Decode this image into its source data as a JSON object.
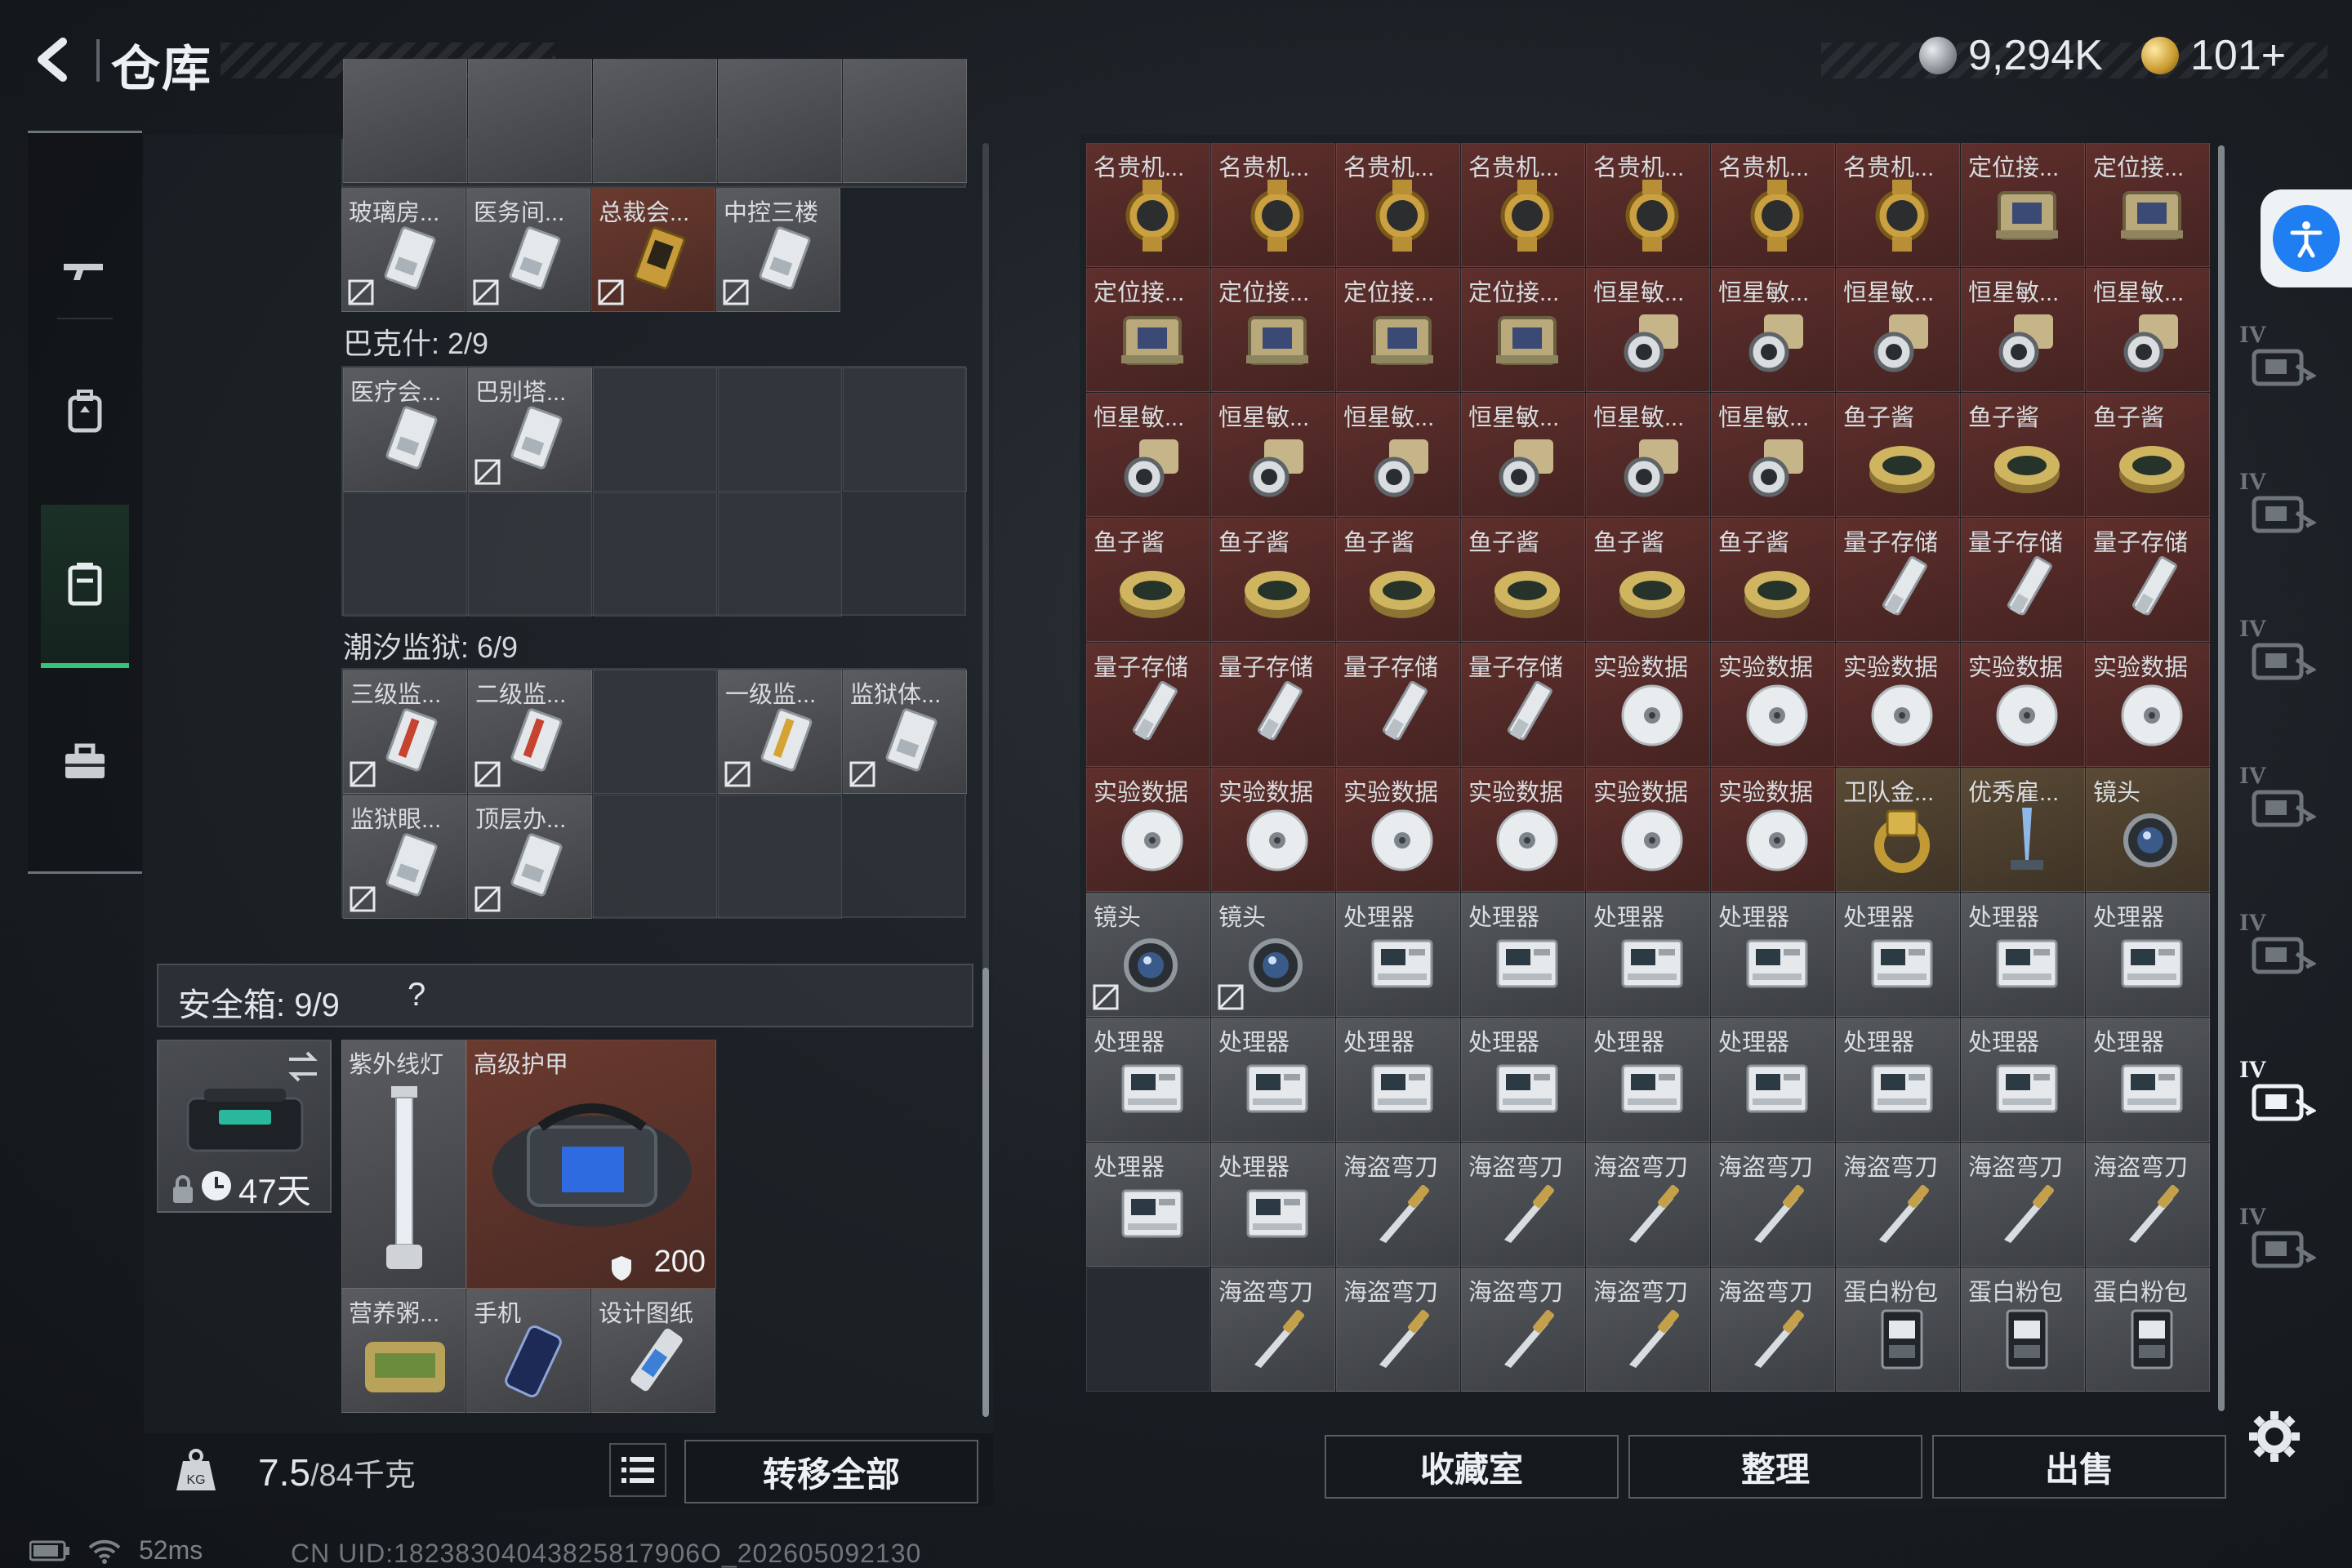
{
  "header": {
    "title": "仓库",
    "currency_1": "9,294K",
    "currency_2": "101+"
  },
  "nav": {
    "items": [
      "weapon-icon",
      "backpack-icon",
      "storage-icon",
      "toolbox-icon"
    ],
    "active_index": 2
  },
  "storage": {
    "top_partial_row": [
      "",
      "",
      "",
      "",
      ""
    ],
    "row_a": [
      "玻璃房...",
      "医务间...",
      "总裁会...",
      "中控三楼"
    ],
    "section_bakshi": {
      "label": "巴克什: 2/9",
      "items": [
        "医疗会...",
        "巴别塔..."
      ]
    },
    "section_tide": {
      "label": "潮汐监狱: 6/9",
      "row1": [
        "三级监...",
        "二级监...",
        "",
        "一级监...",
        "监狱体..."
      ],
      "row2": [
        "监狱眼...",
        "顶层办..."
      ]
    },
    "safe_box": {
      "label": "安全箱:  9/9",
      "help": "?",
      "days": "47天",
      "items": [
        "紫外线灯",
        "高级护甲",
        "营养粥...",
        "手机",
        "设计图纸"
      ],
      "armor_value": "200"
    },
    "weight": {
      "current": "7.5",
      "max": "/84千克"
    },
    "transfer_all": "转移全部"
  },
  "inventory": {
    "items": [
      "名贵机...",
      "名贵机...",
      "名贵机...",
      "名贵机...",
      "名贵机...",
      "名贵机...",
      "名贵机...",
      "定位接...",
      "定位接...",
      "定位接...",
      "定位接...",
      "定位接...",
      "定位接...",
      "恒星敏...",
      "恒星敏...",
      "恒星敏...",
      "恒星敏...",
      "恒星敏...",
      "恒星敏...",
      "恒星敏...",
      "恒星敏...",
      "恒星敏...",
      "恒星敏...",
      "恒星敏...",
      "鱼子酱",
      "鱼子酱",
      "鱼子酱",
      "鱼子酱",
      "鱼子酱",
      "鱼子酱",
      "鱼子酱",
      "鱼子酱",
      "鱼子酱",
      "量子存储",
      "量子存储",
      "量子存储",
      "量子存储",
      "量子存储",
      "量子存储",
      "量子存储",
      "实验数据",
      "实验数据",
      "实验数据",
      "实验数据",
      "实验数据",
      "实验数据",
      "实验数据",
      "实验数据",
      "实验数据",
      "实验数据",
      "实验数据",
      "卫队金...",
      "优秀雇...",
      "镜头",
      "镜头",
      "镜头",
      "处理器",
      "处理器",
      "处理器",
      "处理器",
      "处理器",
      "处理器",
      "处理器",
      "处理器",
      "处理器",
      "处理器",
      "处理器",
      "处理器",
      "处理器",
      "处理器",
      "处理器",
      "处理器",
      "处理器",
      "处理器",
      "海盗弯刀",
      "海盗弯刀",
      "海盗弯刀",
      "海盗弯刀",
      "海盗弯刀",
      "海盗弯刀",
      "海盗弯刀",
      "",
      "海盗弯刀",
      "海盗弯刀",
      "海盗弯刀",
      "海盗弯刀",
      "海盗弯刀",
      "蛋白粉包",
      "蛋白粉包",
      "蛋白粉包"
    ],
    "buttons": {
      "collection": "收藏室",
      "sort": "整理",
      "sell": "出售"
    }
  },
  "rail": {
    "tiers": [
      "IV",
      "IV",
      "IV",
      "IV",
      "IV",
      "IV",
      "IV"
    ],
    "active_index": 5
  },
  "status": {
    "ping": "52ms",
    "uid": "CN UID:18238304043825817906O_202605092130"
  }
}
